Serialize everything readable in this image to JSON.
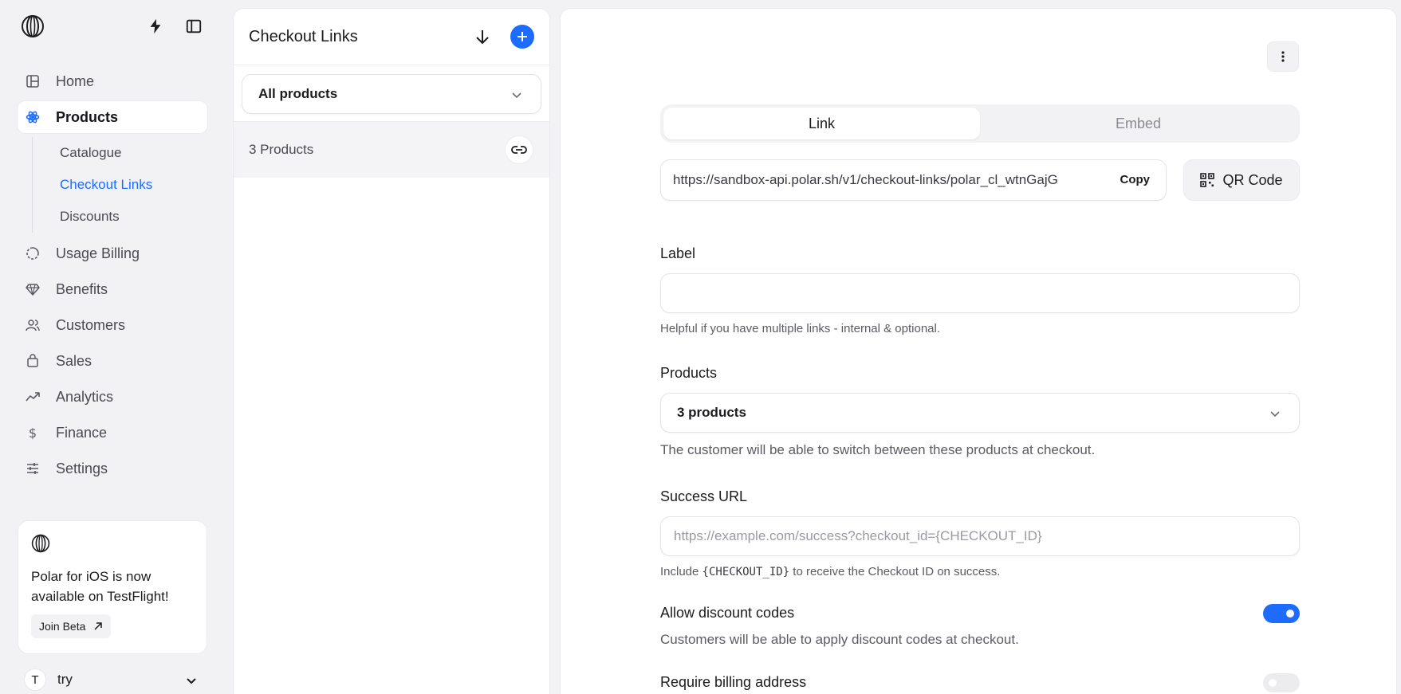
{
  "sidebar": {
    "nav": [
      {
        "label": "Home",
        "icon": "home-icon"
      },
      {
        "label": "Products",
        "icon": "products-icon",
        "active": true
      },
      {
        "label": "Usage Billing",
        "icon": "usage-billing-icon"
      },
      {
        "label": "Benefits",
        "icon": "benefits-icon"
      },
      {
        "label": "Customers",
        "icon": "customers-icon"
      },
      {
        "label": "Sales",
        "icon": "sales-icon"
      },
      {
        "label": "Analytics",
        "icon": "analytics-icon"
      },
      {
        "label": "Finance",
        "icon": "finance-icon"
      },
      {
        "label": "Settings",
        "icon": "settings-icon"
      }
    ],
    "subnav": [
      {
        "label": "Catalogue"
      },
      {
        "label": "Checkout Links",
        "active": true
      },
      {
        "label": "Discounts"
      }
    ],
    "beta_card": {
      "text": "Polar for iOS is now available on TestFlight!",
      "button": "Join Beta"
    },
    "account": {
      "initial": "T",
      "name": "try"
    }
  },
  "list_panel": {
    "title": "Checkout Links",
    "filter": "All products",
    "rows": [
      {
        "label": "3 Products"
      }
    ]
  },
  "editor": {
    "tabs": [
      {
        "label": "Link",
        "active": true
      },
      {
        "label": "Embed"
      }
    ],
    "url": "https://sandbox-api.polar.sh/v1/checkout-links/polar_cl_wtnGajG",
    "copy_label": "Copy",
    "qr_label": "QR Code",
    "label_field": {
      "label": "Label",
      "value": "",
      "help": "Helpful if you have multiple links - internal & optional."
    },
    "products_field": {
      "label": "Products",
      "value": "3 products",
      "help": "The customer will be able to switch between these products at checkout."
    },
    "success_url_field": {
      "label": "Success URL",
      "placeholder": "https://example.com/success?checkout_id={CHECKOUT_ID}",
      "help_prefix": "Include",
      "help_code": "{CHECKOUT_ID}",
      "help_suffix": "to receive the Checkout ID on success."
    },
    "allow_discounts": {
      "label": "Allow discount codes",
      "help": "Customers will be able to apply discount codes at checkout.",
      "enabled": true
    },
    "require_billing": {
      "label": "Require billing address",
      "enabled": false
    }
  },
  "colors": {
    "accent": "#1d6bff",
    "background": "#f2f2f5"
  }
}
